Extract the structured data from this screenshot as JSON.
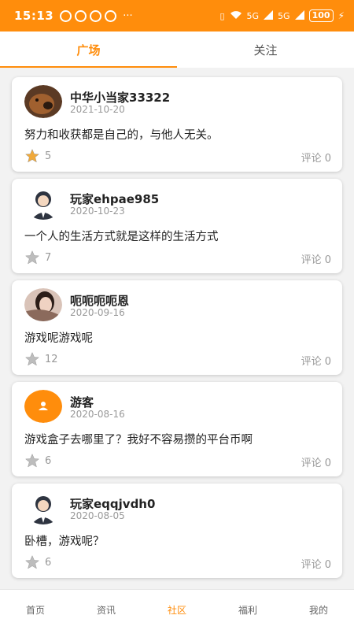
{
  "status_bar": {
    "time": "15:13",
    "dots": "···",
    "battery": "100",
    "signal_1": "5G",
    "signal_2": "5G"
  },
  "tabs": [
    {
      "label": "广场",
      "active": true
    },
    {
      "label": "关注",
      "active": false
    }
  ],
  "posts": [
    {
      "name": "中华小当家33322",
      "date": "2021-10-20",
      "content": "努力和收获都是自己的，与他人无关。",
      "likes": "5",
      "comment": "评论 0",
      "avatar": "dog-photo",
      "liked": true
    },
    {
      "name": "玩家ehpae985",
      "date": "2020-10-23",
      "content": "一个人的生活方式就是这样的生活方式",
      "likes": "7",
      "comment": "评论 0",
      "avatar": "default-man",
      "liked": false
    },
    {
      "name": "呃呃呃呃恩",
      "date": "2020-09-16",
      "content": "游戏呢游戏呢",
      "likes": "12",
      "comment": "评论 0",
      "avatar": "girl-photo",
      "liked": false
    },
    {
      "name": "游客",
      "date": "2020-08-16",
      "content": "游戏盒子去哪里了？我好不容易攒的平台币啊",
      "likes": "6",
      "comment": "评论 0",
      "avatar": "guest-orange",
      "liked": false
    },
    {
      "name": "玩家eqqjvdh0",
      "date": "2020-08-05",
      "content": "卧槽，游戏呢？",
      "likes": "6",
      "comment": "评论 0",
      "avatar": "default-man",
      "liked": false
    }
  ],
  "bottom_nav": [
    {
      "label": "首页",
      "active": false
    },
    {
      "label": "资讯",
      "active": false
    },
    {
      "label": "社区",
      "active": true
    },
    {
      "label": "福利",
      "active": false
    },
    {
      "label": "我的",
      "active": false
    }
  ],
  "colors": {
    "accent": "#ff8d0c",
    "star_active": "#f0a93a",
    "star_inactive": "#bdbdbd"
  }
}
